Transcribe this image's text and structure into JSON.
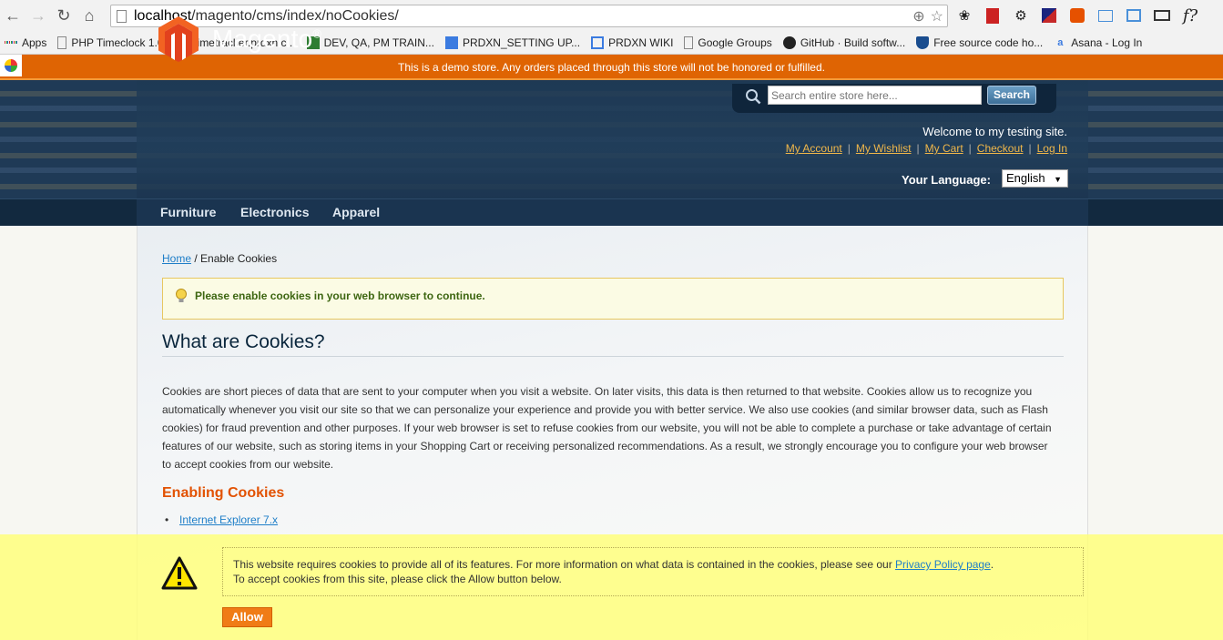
{
  "browser": {
    "url_host": "localhost",
    "url_path": "/magento/cms/index/noCookies/",
    "bookmarks": [
      {
        "label": "Apps"
      },
      {
        "label": "PHP Timeclock 1.04"
      },
      {
        "label": "timetracker.prdxn.c..."
      },
      {
        "label": "DEV, QA, PM TRAIN..."
      },
      {
        "label": "PRDXN_SETTING UP..."
      },
      {
        "label": "PRDXN WIKI"
      },
      {
        "label": "Google Groups"
      },
      {
        "label": "GitHub · Build softw..."
      },
      {
        "label": "Free source code ho..."
      },
      {
        "label": "Asana - Log In"
      }
    ]
  },
  "demo_notice": "This is a demo store. Any orders placed through this store will not be honored or fulfilled.",
  "header": {
    "logo_text": "Magento",
    "logo_reg": "®",
    "search_placeholder": "Search entire store here...",
    "search_button": "Search",
    "welcome": "Welcome to my testing site.",
    "links": [
      "My Account",
      "My Wishlist",
      "My Cart",
      "Checkout",
      "Log In"
    ],
    "language_label": "Your Language:",
    "language_value": "English"
  },
  "nav": [
    "Furniture",
    "Electronics",
    "Apparel"
  ],
  "breadcrumb": {
    "home": "Home",
    "separator": "/",
    "current": "Enable Cookies"
  },
  "notice_message": "Please enable cookies in your web browser to continue.",
  "heading": "What are Cookies?",
  "paragraph": "Cookies are short pieces of data that are sent to your computer when you visit a website. On later visits, this data is then returned to that website. Cookies allow us to recognize you automatically whenever you visit our site so that we can personalize your experience and provide you with better service. We also use cookies (and similar browser data, such as Flash cookies) for fraud prevention and other purposes. If your web browser is set to refuse cookies from our website, you will not be able to complete a purchase or take advantage of certain features of our website, such as storing items in your Shopping Cart or receiving personalized recommendations. As a result, we strongly encourage you to configure your web browser to accept cookies from our website.",
  "subheading": "Enabling Cookies",
  "list_items": [
    "Internet Explorer 7.x"
  ],
  "cookie_notice": {
    "text_before_link": "This website requires cookies to provide all of its features. For more information on what data is contained in the cookies, please see our ",
    "link": "Privacy Policy page",
    "text_after_link": ".",
    "line2": "To accept cookies from this site, please click the Allow button below.",
    "allow_button": "Allow"
  },
  "colors": {
    "demo_bar": "#df6403",
    "header_bg": "#1f3a56",
    "link": "#1e7ec8",
    "accent_orange": "#e25203",
    "cookie_overlay": "#ffff78"
  }
}
